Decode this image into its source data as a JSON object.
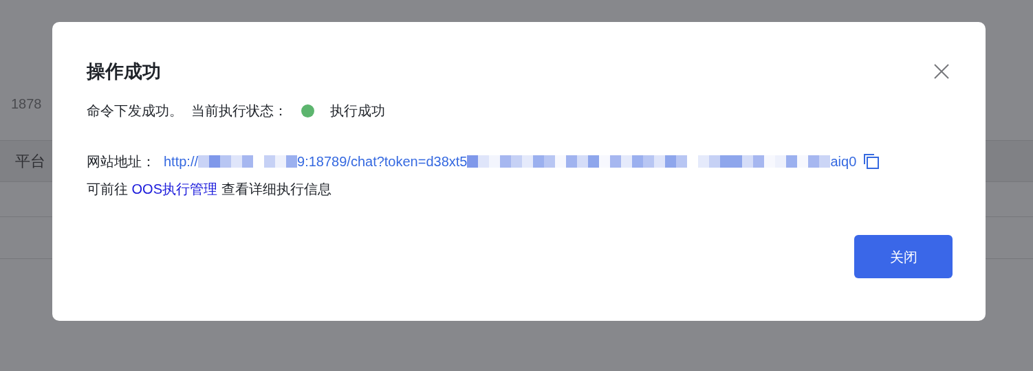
{
  "background": {
    "texts": [
      "1878",
      "平台"
    ]
  },
  "dialog": {
    "title": "操作成功",
    "status": {
      "message": "命令下发成功。",
      "label": "当前执行状态：",
      "color": "#5cb56e",
      "value": "执行成功"
    },
    "website": {
      "label": "网站地址：",
      "url_parts": [
        "http://",
        "9:18789/chat?token=d38xt5",
        "aiq0"
      ]
    },
    "hint": {
      "before": "可前往",
      "link": "OOS执行管理",
      "after": "查看详细执行信息"
    },
    "button": "关闭"
  }
}
